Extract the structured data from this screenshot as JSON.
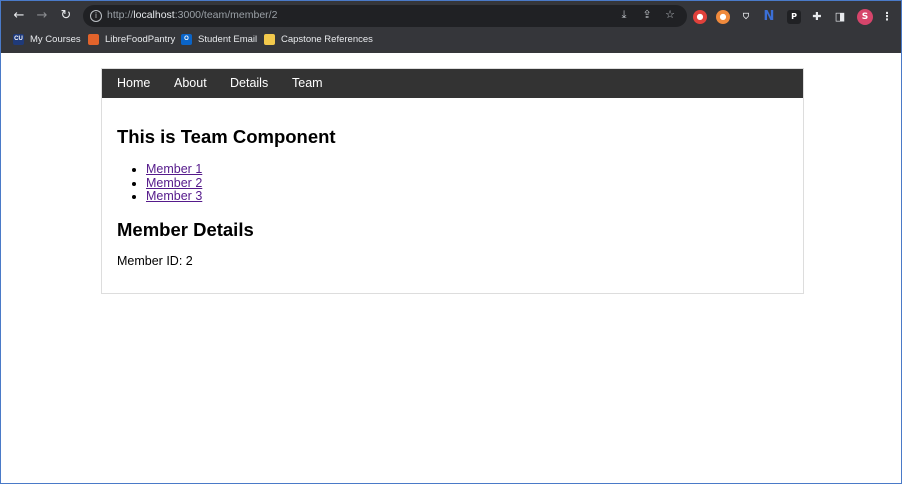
{
  "browser": {
    "url_scheme": "http://",
    "url_host": "localhost",
    "url_path": ":3000/team/member/2",
    "profile_initial": "S",
    "bookmarks": [
      {
        "label": "My Courses",
        "icon": "cu-logo-icon",
        "color": "#1f3a7a",
        "glyph": "CU"
      },
      {
        "label": "LibreFoodPantry",
        "icon": "gitlab-fox-icon",
        "color": "#e2632b",
        "glyph": ""
      },
      {
        "label": "Student Email",
        "icon": "outlook-icon",
        "color": "#0a64c8",
        "glyph": "O"
      },
      {
        "label": "Capstone References",
        "icon": "folder-icon",
        "color": "#f2c94c",
        "glyph": ""
      }
    ]
  },
  "app": {
    "nav": [
      "Home",
      "About",
      "Details",
      "Team"
    ],
    "title": "This is Team Component",
    "members": [
      "Member 1",
      "Member 2",
      "Member 3"
    ],
    "details_heading": "Member Details",
    "member_id": "Member ID: 2"
  }
}
